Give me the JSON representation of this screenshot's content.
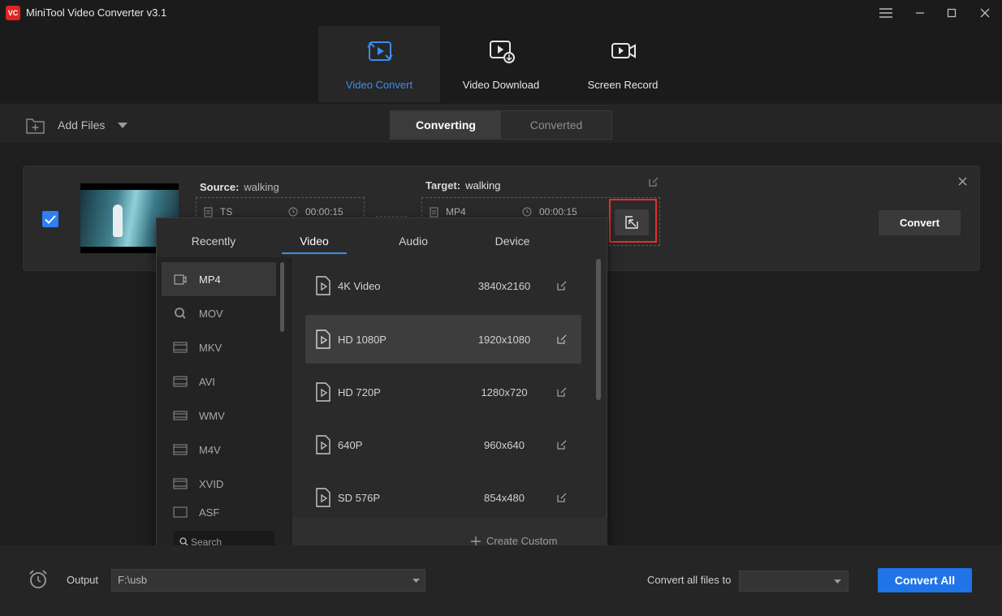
{
  "app": {
    "logo_text": "VC",
    "title": "MiniTool Video Converter v3.1"
  },
  "window_controls": [
    "menu-icon",
    "minimize-icon",
    "maximize-icon",
    "close-icon"
  ],
  "mode_tabs": [
    {
      "label": "Video Convert",
      "icon": "video-convert-icon",
      "active": true
    },
    {
      "label": "Video Download",
      "icon": "video-download-icon",
      "active": false
    },
    {
      "label": "Screen Record",
      "icon": "screen-record-icon",
      "active": false
    }
  ],
  "toolbar": {
    "add_files": "Add Files",
    "tabs": [
      {
        "label": "Converting",
        "active": true
      },
      {
        "label": "Converted",
        "active": false
      }
    ]
  },
  "task": {
    "checked": true,
    "source": {
      "label": "Source:",
      "name": "walking",
      "format": "TS",
      "duration": "00:00:15"
    },
    "target": {
      "label": "Target:",
      "name": "walking",
      "format": "MP4",
      "duration": "00:00:15"
    },
    "convert_label": "Convert"
  },
  "format_panel": {
    "tabs": [
      {
        "label": "Recently",
        "active": false
      },
      {
        "label": "Video",
        "active": true
      },
      {
        "label": "Audio",
        "active": false
      },
      {
        "label": "Device",
        "active": false
      }
    ],
    "formats": [
      {
        "label": "MP4",
        "active": true
      },
      {
        "label": "MOV",
        "active": false
      },
      {
        "label": "MKV",
        "active": false
      },
      {
        "label": "AVI",
        "active": false
      },
      {
        "label": "WMV",
        "active": false
      },
      {
        "label": "M4V",
        "active": false
      },
      {
        "label": "XVID",
        "active": false
      },
      {
        "label": "ASF",
        "active": false
      }
    ],
    "search_placeholder": "Search",
    "presets": [
      {
        "name": "4K Video",
        "resolution": "3840x2160",
        "active": false
      },
      {
        "name": "HD 1080P",
        "resolution": "1920x1080",
        "active": true
      },
      {
        "name": "HD 720P",
        "resolution": "1280x720",
        "active": false
      },
      {
        "name": "640P",
        "resolution": "960x640",
        "active": false
      },
      {
        "name": "SD 576P",
        "resolution": "854x480",
        "active": false
      }
    ],
    "create_custom": "Create Custom"
  },
  "bottom": {
    "output_label": "Output",
    "output_path": "F:\\usb",
    "convert_all_to_label": "Convert all files to",
    "convert_all_to_value": "",
    "convert_all_button": "Convert All"
  },
  "colors": {
    "accent": "#3b8cf0",
    "primary_button": "#1f74e8",
    "highlight_frame": "#e2302b",
    "background": "#1e1e1e"
  }
}
